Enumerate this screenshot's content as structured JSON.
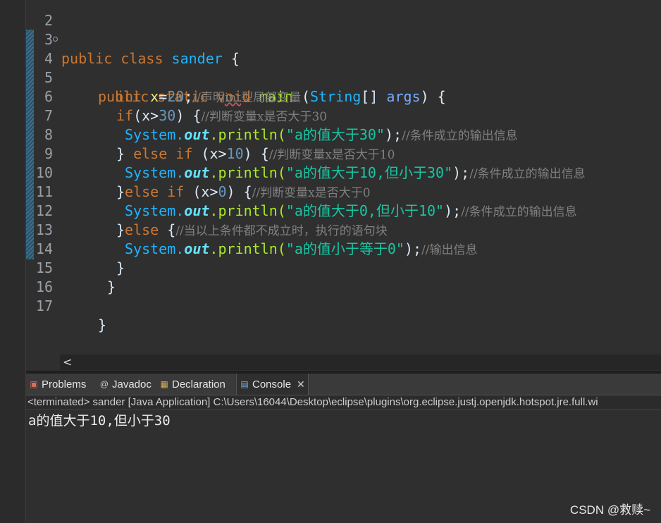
{
  "editor": {
    "lines": [
      {
        "num": "2"
      },
      {
        "num": "3",
        "t": {
          "kw1": "public class ",
          "cls": "sander",
          "rest": " {"
        }
      },
      {
        "num": "4",
        "t": {
          "kw1": "public static void ",
          "method": "main",
          "sp": " (",
          "type": "String",
          "br": "[] ",
          "param": "args",
          "end": ") {"
        }
      },
      {
        "num": "5",
        "t": {
          "kw": "int ",
          "var": "x",
          "eq": "=",
          "num": "20",
          "semi": ";",
          "cmt1": "//声明",
          "sq": "int",
          "cmt2": "型局部变量"
        }
      },
      {
        "num": "6",
        "t": {
          "kw": "if",
          "p1": "(x>",
          "num": "30",
          "p2": ") {",
          "cmt": "//判断变量x是否大于30"
        }
      },
      {
        "num": "7",
        "t": {
          "sys": "System.",
          "field": "out",
          "call": ".println(",
          "str": "\"a的值大于30\"",
          "end": ");",
          "cmt": "//条件成立的输出信息"
        }
      },
      {
        "num": "8",
        "t": {
          "pre": "} ",
          "kw": "else if ",
          "p1": "(x>",
          "num": "10",
          "p2": ") {",
          "cmt": "//判断变量x是否大于10"
        }
      },
      {
        "num": "9",
        "t": {
          "sys": "System.",
          "field": "out",
          "call": ".println(",
          "str": "\"a的值大于10,但小于30\"",
          "end": ");",
          "cmt": "//条件成立的输出信息"
        }
      },
      {
        "num": "10",
        "t": {
          "pre": "}",
          "kw": "else if ",
          "p1": "(x>",
          "num": "0",
          "p2": ") {",
          "cmt": "//判断变量x是否大于0"
        }
      },
      {
        "num": "11",
        "t": {
          "sys": "System.",
          "field": "out",
          "call": ".println(",
          "str": "\"a的值大于0,但小于10\"",
          "end": ");",
          "cmt": "//条件成立的输出信息"
        }
      },
      {
        "num": "12",
        "t": {
          "pre": "}",
          "kw": "else ",
          "p2": "{",
          "cmt": "//当以上条件都不成立时，执行的语句块"
        }
      },
      {
        "num": "13",
        "t": {
          "sys": "System.",
          "field": "out",
          "call": ".println(",
          "str": "\"a的值小于等于0\"",
          "end": ");",
          "cmt": "//输出信息"
        }
      },
      {
        "num": "14",
        "t": {
          "pre": "}"
        }
      },
      {
        "num": "15",
        "t": {
          "pre": "}"
        }
      },
      {
        "num": "16"
      },
      {
        "num": "17",
        "t": {
          "pre": "}"
        }
      }
    ],
    "scroll_arrow": "<"
  },
  "panel": {
    "tabs": [
      {
        "label": "Problems",
        "icon": "problems-icon"
      },
      {
        "label": "Javadoc",
        "icon": "javadoc-icon"
      },
      {
        "label": "Declaration",
        "icon": "declaration-icon"
      },
      {
        "label": "Console",
        "icon": "console-icon",
        "active": true
      }
    ],
    "status": "<terminated> sander [Java Application] C:\\Users\\16044\\Desktop\\eclipse\\plugins\\org.eclipse.justj.openjdk.hotspot.jre.full.wi",
    "output": "a的值大于10,但小于30"
  },
  "watermark": "CSDN @救赎~",
  "colors": {
    "keyword": "#cc7832",
    "class": "#1eb5ff",
    "method": "#a7ec21",
    "string": "#17c6a3",
    "comment": "#808080",
    "number": "#6897bb",
    "variable": "#f3ec79"
  }
}
